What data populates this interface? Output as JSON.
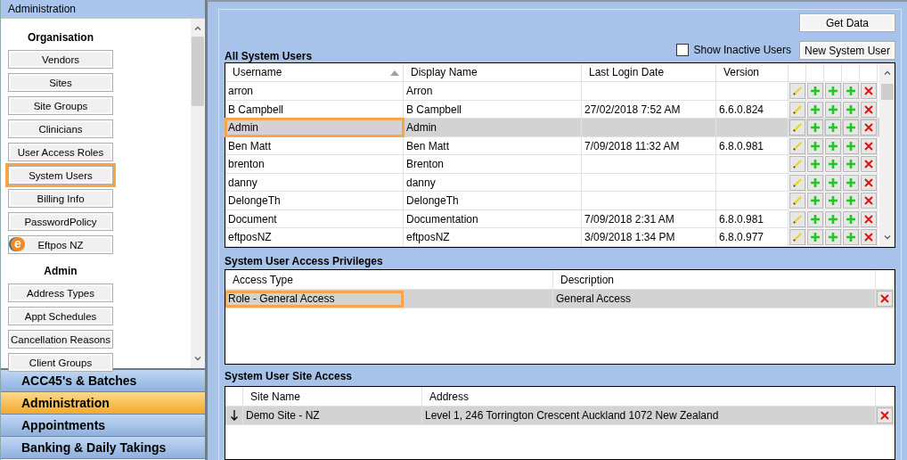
{
  "sidebar": {
    "header": "Administration",
    "sections": [
      {
        "title": "Organisation",
        "items": [
          {
            "label": "Vendors",
            "highlighted": false
          },
          {
            "label": "Sites",
            "highlighted": false
          },
          {
            "label": "Site Groups",
            "highlighted": false
          },
          {
            "label": "Clinicians",
            "highlighted": false
          },
          {
            "label": "User Access Roles",
            "highlighted": false
          },
          {
            "label": "System Users",
            "highlighted": true
          },
          {
            "label": "Billing Info",
            "highlighted": false
          },
          {
            "label": "PasswordPolicy",
            "highlighted": false
          },
          {
            "label": "Eftpos NZ",
            "highlighted": false,
            "logo": "e"
          }
        ]
      },
      {
        "title": "Admin",
        "items": [
          {
            "label": "Address Types",
            "highlighted": false
          },
          {
            "label": "Appt Schedules",
            "highlighted": false
          },
          {
            "label": "Cancellation Reasons",
            "highlighted": false
          },
          {
            "label": "Client Groups",
            "highlighted": false
          }
        ]
      }
    ]
  },
  "nav": [
    {
      "label": "ACC45's & Batches",
      "selected": false
    },
    {
      "label": "Administration",
      "selected": true
    },
    {
      "label": "Appointments",
      "selected": false
    },
    {
      "label": "Banking & Daily Takings",
      "selected": false
    }
  ],
  "toolbar": {
    "get_data": "Get Data",
    "show_inactive": {
      "label": "Show Inactive Users",
      "checked": false
    },
    "new_user": "New System User"
  },
  "users": {
    "title": "All System Users",
    "columns": [
      {
        "label": "Username",
        "sorted": true
      },
      {
        "label": "Display Name",
        "sorted": false
      },
      {
        "label": "Last Login Date",
        "sorted": false
      },
      {
        "label": "Version",
        "sorted": false
      }
    ],
    "rows": [
      {
        "cells": [
          "arron",
          "Arron",
          "",
          ""
        ],
        "selected": false,
        "highlighted": false
      },
      {
        "cells": [
          "B Campbell",
          "B Campbell",
          "27/02/2018 7:52 AM",
          "6.6.0.824"
        ],
        "selected": false,
        "highlighted": false
      },
      {
        "cells": [
          "Admin",
          "Admin",
          "",
          ""
        ],
        "selected": true,
        "highlighted": true
      },
      {
        "cells": [
          "Ben Matt",
          "Ben Matt",
          "7/09/2018 11:32 AM",
          "6.8.0.981"
        ],
        "selected": false,
        "highlighted": false
      },
      {
        "cells": [
          "brenton",
          "Brenton",
          "",
          ""
        ],
        "selected": false,
        "highlighted": false
      },
      {
        "cells": [
          "danny",
          "danny",
          "",
          ""
        ],
        "selected": false,
        "highlighted": false
      },
      {
        "cells": [
          "DelongeTh",
          "DelongeTh",
          "",
          ""
        ],
        "selected": false,
        "highlighted": false
      },
      {
        "cells": [
          "Document",
          "Documentation",
          "7/09/2018 2:31 AM",
          "6.8.0.981"
        ],
        "selected": false,
        "highlighted": false
      },
      {
        "cells": [
          "eftposNZ",
          "eftposNZ",
          "3/09/2018 1:34 PM",
          "6.8.0.977"
        ],
        "selected": false,
        "highlighted": false
      }
    ]
  },
  "privileges": {
    "title": "System User Access Privileges",
    "columns": [
      "Access Type",
      "Description"
    ],
    "rows": [
      {
        "cells": [
          "Role - General Access",
          "General Access"
        ],
        "selected": true,
        "highlighted": true
      }
    ]
  },
  "site_access": {
    "title": "System User Site Access",
    "columns": [
      "Site Name",
      "Address"
    ],
    "rows": [
      {
        "cells": [
          "Demo Site - NZ",
          "Level 1, 246 Torrington Crescent Auckland  1072 New Zealand"
        ],
        "selected": true,
        "highlighted": false
      }
    ]
  }
}
